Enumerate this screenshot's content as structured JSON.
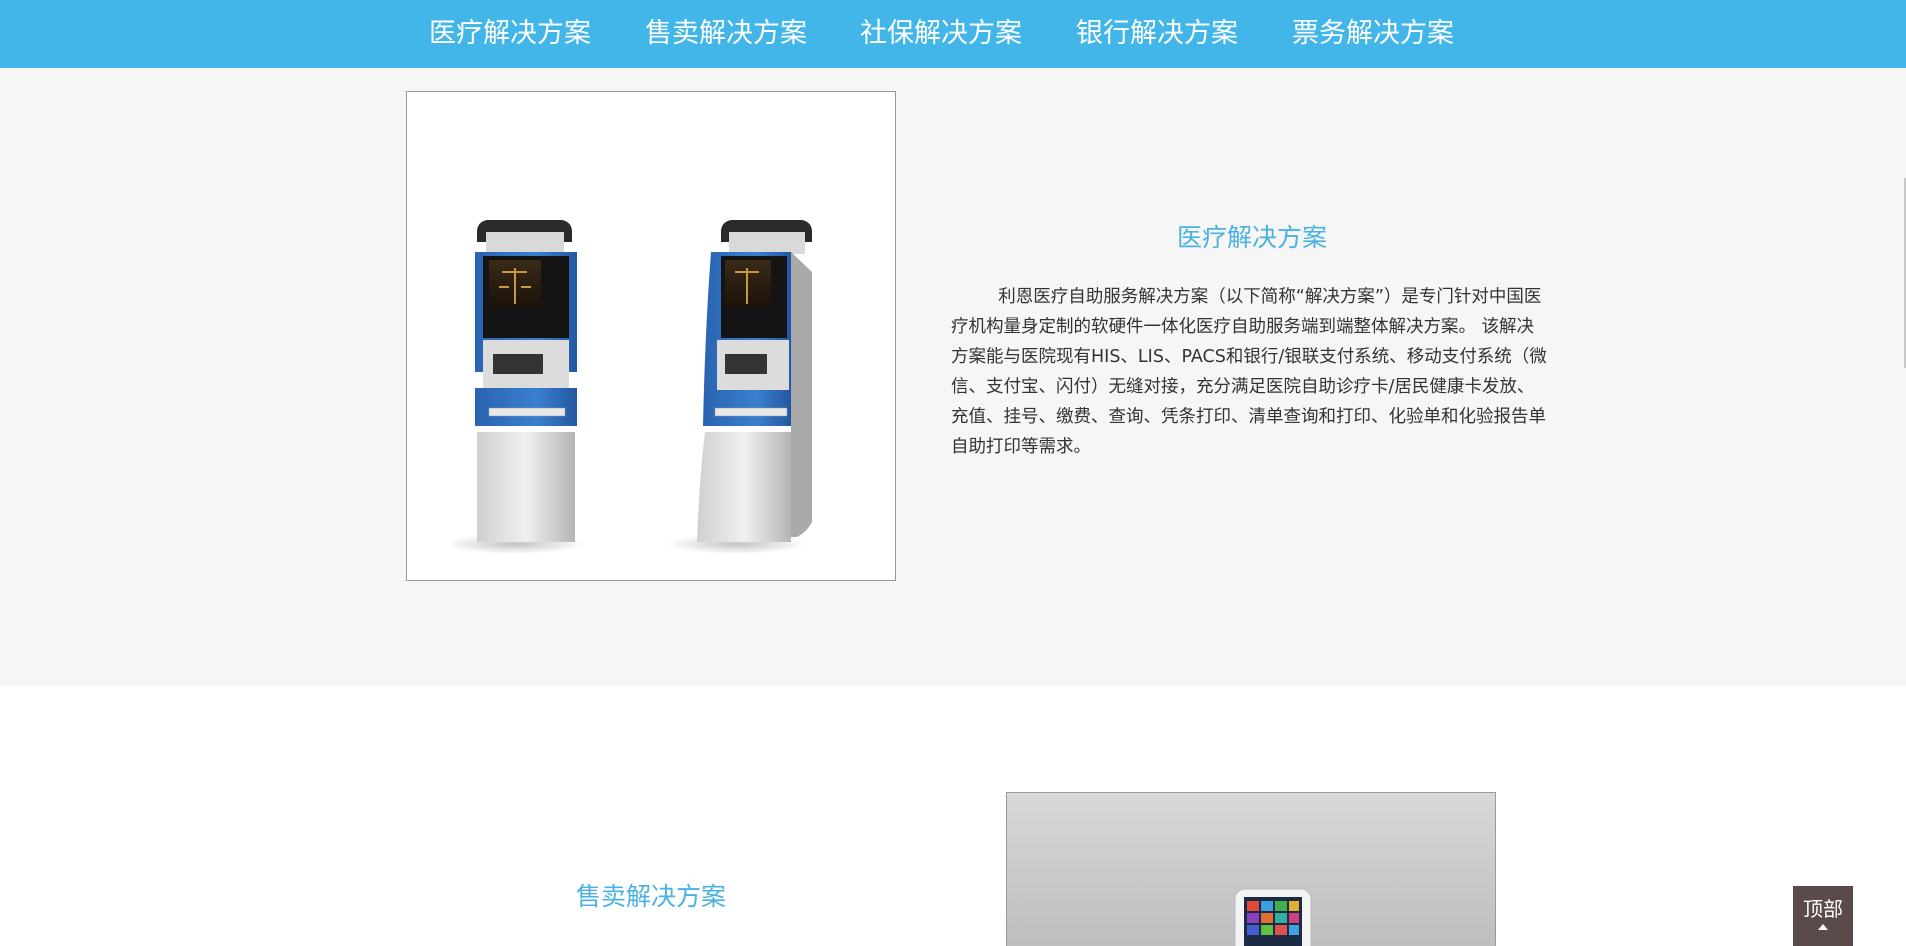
{
  "nav": {
    "items": [
      {
        "label": "医疗解决方案"
      },
      {
        "label": "售卖解决方案"
      },
      {
        "label": "社保解决方案"
      },
      {
        "label": "银行解决方案"
      },
      {
        "label": "票务解决方案"
      }
    ]
  },
  "section1": {
    "title": "医疗解决方案",
    "description": "利恩医疗自助服务解决方案（以下简称“解决方案”）是专门针对中国医疗机构量身定制的软硬件一体化医疗自助服务端到端整体解决方案。 该解决方案能与医院现有HIS、LIS、PACS和银行/银联支付系统、移动支付系统（微信、支付宝、闪付）无缝对接，充分满足医院自助诊疗卡/居民健康卡发放、充值、挂号、缴费、查询、凭条打印、清单查询和打印、化验单和化验报告单自助打印等需求。"
  },
  "section2": {
    "title": "售卖解决方案"
  },
  "back_to_top": {
    "label": "顶部"
  },
  "colors": {
    "nav_bg": "#42b6e8",
    "title_blue": "#4ab2e0",
    "kiosk_blue": "#2f6fc0",
    "back_top_bg": "#5a4a4a"
  }
}
